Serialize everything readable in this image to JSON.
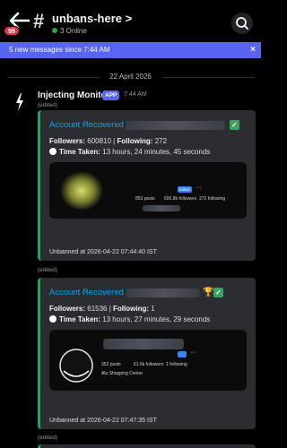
{
  "header": {
    "channel_name": "unbans-here",
    "channel_chevron": ">",
    "online_status": "3 Online",
    "unread_badge": "99"
  },
  "banner": {
    "text": "5 new messages since 7:44 AM",
    "close": "×"
  },
  "date_divider": "22 April 2026",
  "message": {
    "author": "Injecting Monitor",
    "app_tag": "APP",
    "time": "7:44 AM",
    "edited": "(edited)"
  },
  "embeds": [
    {
      "title": "Account Recovered |",
      "followers_label": "Followers:",
      "followers_value": "600810",
      "following_label": "Following:",
      "following_value": "272",
      "time_label": "Time Taken:",
      "time_value": "13 hours, 24 minutes, 45 seconds",
      "image": {
        "posts": "853",
        "posts_label": "posts",
        "followers": "600.8k",
        "followers_label": "followers",
        "following": "272",
        "following_label": "following",
        "button": "follow"
      },
      "footer": "Unbanned at 2026-04-22 07:44:40 IST",
      "edited": "(edited)",
      "emoji": "check"
    },
    {
      "title": "Account Recovered |",
      "followers_label": "Followers:",
      "followers_value": "61536",
      "following_label": "Following:",
      "following_value": "1",
      "time_label": "Time Taken:",
      "time_value": "13 hours, 27 minutes, 29 seconds",
      "image": {
        "posts": "352",
        "posts_label": "posts",
        "followers": "61.5k",
        "followers_label": "followers",
        "following": "1",
        "following_label": "following",
        "bio": "Alu Shopping Center"
      },
      "footer": "Unbanned at 2026-04-22 07:47:35 IST",
      "edited": "(edited)",
      "emoji": "trophy-check"
    }
  ],
  "colors": {
    "accent_bar": "#23a55a",
    "link": "#00a8fc",
    "banner": "#5865f2",
    "badge": "#e0393e"
  },
  "icons": [
    "back-arrow-icon",
    "hash-icon",
    "search-icon",
    "bolt-avatar-icon",
    "clock-icon",
    "check-icon",
    "trophy-icon",
    "close-icon"
  ]
}
